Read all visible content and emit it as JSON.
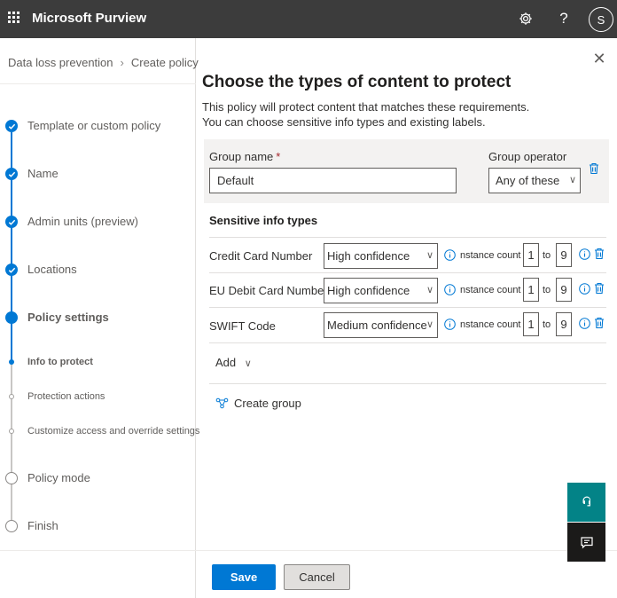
{
  "app": {
    "title": "Microsoft Purview",
    "user_initial": "S"
  },
  "header_icons": [
    "waffle-icon",
    "gear-icon",
    "help-icon"
  ],
  "breadcrumb": {
    "items": [
      "Data loss prevention",
      "Create policy"
    ]
  },
  "steps": [
    {
      "label": "Template or custom policy",
      "state": "done"
    },
    {
      "label": "Name",
      "state": "done"
    },
    {
      "label": "Admin units (preview)",
      "state": "done"
    },
    {
      "label": "Locations",
      "state": "done"
    },
    {
      "label": "Policy settings",
      "state": "current"
    },
    {
      "label": "Info to protect",
      "state": "sub-current"
    },
    {
      "label": "Protection actions",
      "state": "sub-todo"
    },
    {
      "label": "Customize access and override settings",
      "state": "sub-todo"
    },
    {
      "label": "Policy mode",
      "state": "todo"
    },
    {
      "label": "Finish",
      "state": "todo"
    }
  ],
  "main": {
    "title": "Choose the types of content to protect",
    "description_line1": "This policy will protect content that matches these requirements.",
    "description_line2": "You can choose sensitive info types and existing labels.",
    "group": {
      "name_label": "Group name",
      "required_mark": "*",
      "name_value": "Default",
      "operator_label": "Group operator",
      "operator_value": "Any of these"
    },
    "sensitive_section_title": "Sensitive info types",
    "info_types": [
      {
        "name": "Credit Card Number",
        "confidence": "High confidence",
        "instance_label": "nstance count",
        "min": "1",
        "to": "to",
        "max": "9"
      },
      {
        "name": "EU Debit Card Number",
        "confidence": "High confidence",
        "instance_label": "nstance count",
        "min": "1",
        "to": "to",
        "max": "9"
      },
      {
        "name": "SWIFT Code",
        "confidence": "Medium confidence",
        "instance_label": "nstance count",
        "min": "1",
        "to": "to",
        "max": "9"
      }
    ],
    "add_label": "Add",
    "create_group_label": "Create group",
    "save_label": "Save",
    "cancel_label": "Cancel"
  },
  "colors": {
    "accent": "#0078d4",
    "topbar": "#3c3c3c",
    "teal_button": "#038387",
    "dark_button": "#1b1a19"
  }
}
